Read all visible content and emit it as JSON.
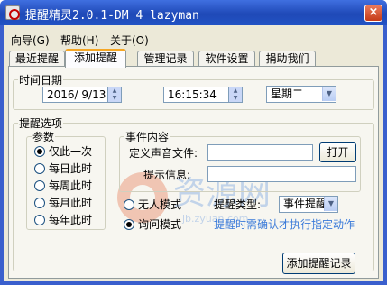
{
  "window": {
    "title": "提醒精灵2.0.1-DM 4 lazyman",
    "close_glyph": "×"
  },
  "menu": [
    {
      "label": "向导(G)"
    },
    {
      "label": "帮助(H)"
    },
    {
      "label": "关于(O)"
    }
  ],
  "tabs": [
    {
      "label": "最近提醒",
      "active": false
    },
    {
      "label": "添加提醒",
      "active": true
    },
    {
      "label": "管理记录",
      "active": false
    },
    {
      "label": "软件设置",
      "active": false
    },
    {
      "label": "捐助我们",
      "active": false
    }
  ],
  "time_group": {
    "legend": "时间日期",
    "date_value": "2016/ 9/13",
    "time_value": "16:15:34",
    "weekday_value": "星期二"
  },
  "options_group": {
    "legend": "提醒选项",
    "params": {
      "legend": "参数",
      "options": [
        {
          "label": "仅此一次",
          "checked": true
        },
        {
          "label": "每日此时",
          "checked": false
        },
        {
          "label": "每周此时",
          "checked": false
        },
        {
          "label": "每月此时",
          "checked": false
        },
        {
          "label": "每年此时",
          "checked": false
        }
      ]
    },
    "event": {
      "legend": "事件内容",
      "sound_label": "定义声音文件:",
      "sound_value": "",
      "open_button": "打开",
      "info_label": "提示信息:",
      "info_value": ""
    },
    "mode": {
      "options": [
        {
          "label": "无人模式",
          "checked": false
        },
        {
          "label": "询问模式",
          "checked": true
        }
      ]
    },
    "type_label": "提醒类型:",
    "type_value": "事件提醒",
    "hint": "提醒时需确认才执行指定动作"
  },
  "add_button": "添加提醒记录",
  "colors": {
    "titlebar": "#2152c4",
    "tab_accent": "#f5a623",
    "hint_text": "#3a7ad9",
    "watermark": "#e04a1a"
  },
  "watermark": {
    "text": "资源网",
    "subtext": "jb.zyuan.com"
  }
}
